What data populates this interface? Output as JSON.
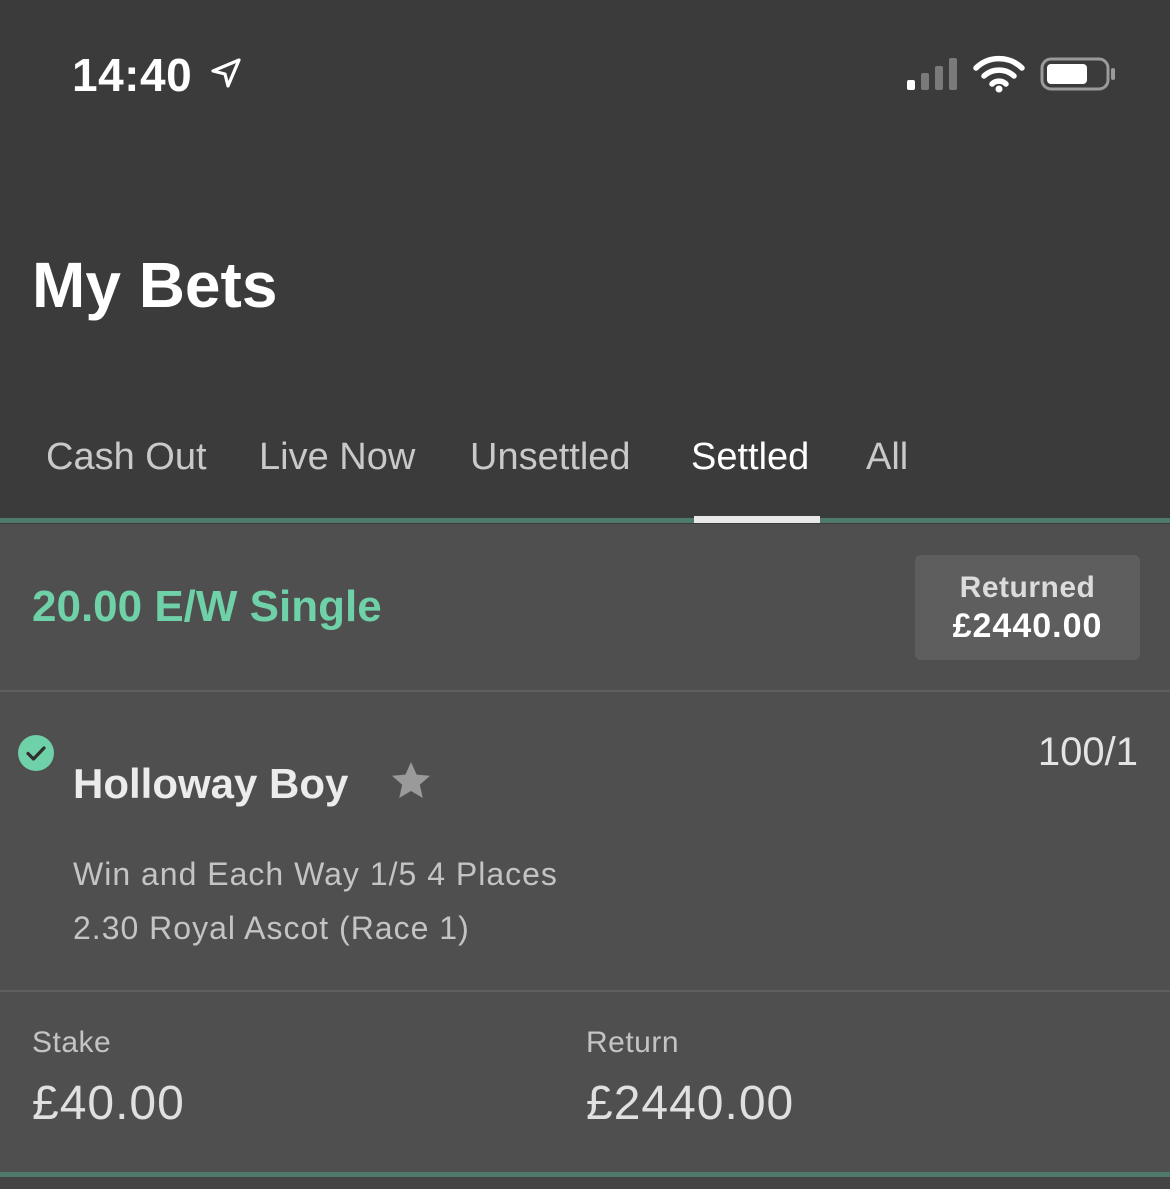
{
  "status_bar": {
    "time": "14:40",
    "icons": [
      "location-arrow-icon",
      "cellular-signal-icon",
      "wifi-icon",
      "battery-icon"
    ]
  },
  "header": {
    "title": "My Bets"
  },
  "tabs": [
    {
      "label": "Cash Out",
      "active": false
    },
    {
      "label": "Live Now",
      "active": false
    },
    {
      "label": "Unsettled",
      "active": false
    },
    {
      "label": "Settled",
      "active": true
    },
    {
      "label": "All",
      "active": false
    }
  ],
  "bet": {
    "type": "20.00 E/W Single",
    "returned_label": "Returned",
    "returned_amount": "£2440.00",
    "selection": {
      "name": "Holloway Boy",
      "odds": "100/1",
      "market": "Win and Each Way 1/5 4 Places",
      "event": "2.30 Royal Ascot (Race 1)",
      "status_icon": "check-circle-icon",
      "favourite_icon": "star-icon"
    },
    "stake_label": "Stake",
    "stake_value": "£40.00",
    "return_label": "Return",
    "return_value": "£2440.00"
  },
  "colors": {
    "background": "#3b3b3b",
    "card": "#4f4f4f",
    "accent_green": "#6fd1a7",
    "tab_track": "#4e7a6a"
  }
}
